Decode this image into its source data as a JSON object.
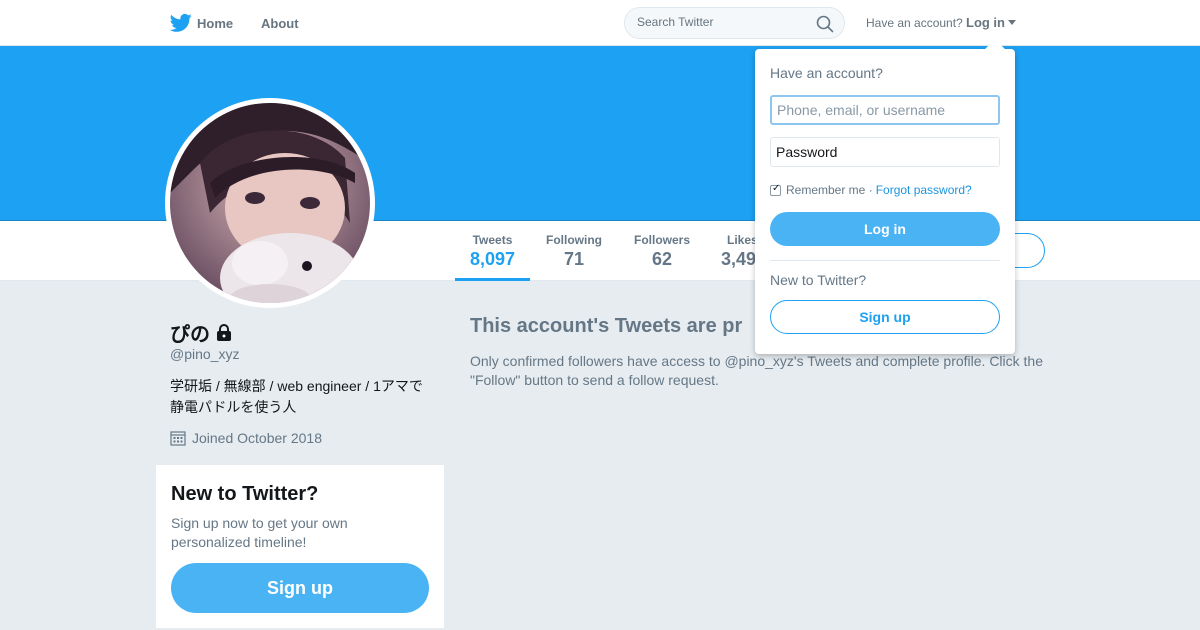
{
  "nav": {
    "home_label": "Home",
    "about_label": "About",
    "search_placeholder": "Search Twitter",
    "have_account": "Have an account?",
    "login_label": "Log in"
  },
  "profile": {
    "name": "ぴの",
    "handle": "@pino_xyz",
    "bio_line1": "学研垢 / 無線部 / web engineer / 1アマで",
    "bio_line2": "静電パドルを使う人",
    "joined": "Joined October 2018"
  },
  "stats": [
    {
      "label": "Tweets",
      "value": "8,097"
    },
    {
      "label": "Following",
      "value": "71"
    },
    {
      "label": "Followers",
      "value": "62"
    },
    {
      "label": "Likes",
      "value": "3,49"
    }
  ],
  "protected": {
    "title": "This account's Tweets are pr",
    "text": "Only confirmed followers have access to @pino_xyz's Tweets and complete profile. Click the \"Follow\" button to send a follow request."
  },
  "new_to_twitter": {
    "title": "New to Twitter?",
    "text": "Sign up now to get your own personalized timeline!",
    "signup_label": "Sign up"
  },
  "login_dropdown": {
    "title": "Have an account?",
    "username_placeholder": "Phone, email, or username",
    "password_placeholder": "Password",
    "remember_label": "Remember me ·",
    "forgot_label": "Forgot password?",
    "login_button": "Log in",
    "new_label": "New to Twitter?",
    "signup_button": "Sign up"
  },
  "colors": {
    "brand": "#1da1f2",
    "button": "#4ab3f4",
    "background": "#e6ecf0"
  }
}
